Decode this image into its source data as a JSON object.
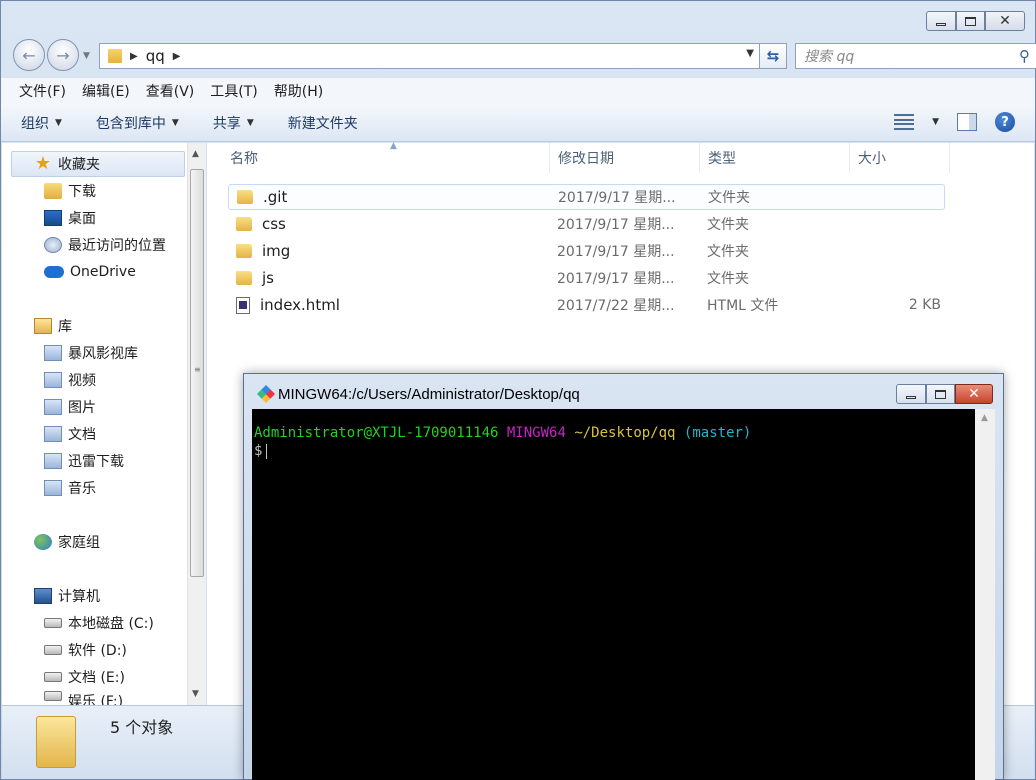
{
  "explorer": {
    "address": {
      "crumb": "qq"
    },
    "search": {
      "placeholder": "搜索 qq"
    },
    "menu": [
      "文件(F)",
      "编辑(E)",
      "查看(V)",
      "工具(T)",
      "帮助(H)"
    ],
    "toolbar": {
      "organize": "组织",
      "include_in_library": "包含到库中",
      "share": "共享",
      "new_folder": "新建文件夹"
    },
    "nav": {
      "favorites": "收藏夹",
      "downloads": "下载",
      "desktop": "桌面",
      "recent": "最近访问的位置",
      "onedrive": "OneDrive",
      "libraries": "库",
      "storm": "暴风影视库",
      "videos": "视频",
      "pictures": "图片",
      "documents": "文档",
      "thunder": "迅雷下载",
      "music": "音乐",
      "homegroup": "家庭组",
      "computer": "计算机",
      "drive_c": "本地磁盘 (C:)",
      "drive_d": "软件 (D:)",
      "drive_e": "文档 (E:)",
      "drive_f": "娱乐 (F:)"
    },
    "columns": {
      "name": "名称",
      "modified": "修改日期",
      "type": "类型",
      "size": "大小"
    },
    "files": [
      {
        "name": ".git",
        "modified": "2017/9/17 星期...",
        "type": "文件夹",
        "size": "",
        "icon": "folder-icon"
      },
      {
        "name": "css",
        "modified": "2017/9/17 星期...",
        "type": "文件夹",
        "size": "",
        "icon": "folder-icon"
      },
      {
        "name": "img",
        "modified": "2017/9/17 星期...",
        "type": "文件夹",
        "size": "",
        "icon": "folder-icon"
      },
      {
        "name": "js",
        "modified": "2017/9/17 星期...",
        "type": "文件夹",
        "size": "",
        "icon": "folder-icon"
      },
      {
        "name": "index.html",
        "modified": "2017/7/22 星期...",
        "type": "HTML 文件",
        "size": "2 KB",
        "icon": "html-file-icon"
      }
    ],
    "status": "5 个对象"
  },
  "terminal": {
    "title": "MINGW64:/c/Users/Administrator/Desktop/qq",
    "prompt_user": "Administrator@XTJL-1709011146",
    "prompt_env": "MINGW64",
    "prompt_path": "~/Desktop/qq",
    "prompt_branch": "(master)",
    "prompt_symbol": "$",
    "colors": {
      "user": "#1fd41f",
      "env": "#c622c6",
      "path": "#d9c23f",
      "branch": "#22b6c8"
    }
  }
}
